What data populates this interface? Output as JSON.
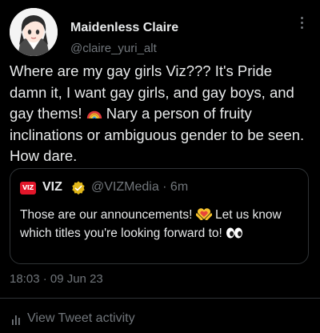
{
  "author": {
    "display_name": "Maidenless Claire",
    "handle": "@claire_yuri_alt"
  },
  "tweet": {
    "text_part1": "Where are my gay girls Viz??? It's Pride damn it, I want gay girls, and gay boys, and gay thems! ",
    "text_part2": " Nary a person of fruity inclinations or ambiguous gender to be seen. How dare.",
    "emoji": "rainbow-emoji"
  },
  "quote": {
    "logo_text": "VIZ",
    "name": "VIZ",
    "handle_time": "@VIZMedia · 6m",
    "text_part1": "Those are our announcements! ",
    "text_part2": " Let us know which titles you're looking forward to! ",
    "emojis": [
      "hands-heart-emoji",
      "eyes-emoji"
    ]
  },
  "timestamp": "18:03 · 09 Jun 23",
  "activity_label": "View Tweet activity",
  "colors": {
    "background": "#000000",
    "text": "#e7e9ea",
    "muted": "#71767b",
    "border": "#2f3336",
    "verified": "#e2b719",
    "viz_red": "#e2162a"
  }
}
